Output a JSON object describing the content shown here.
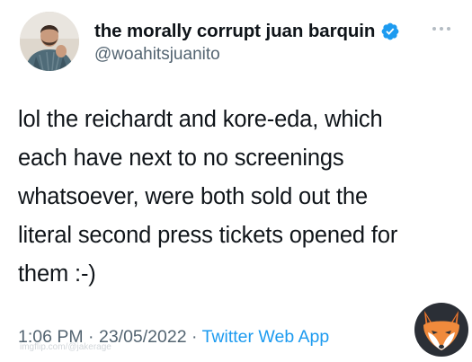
{
  "tweet": {
    "display_name": "the morally corrupt juan barquin",
    "handle": "@woahitsjuanito",
    "verified": true,
    "verified_icon": "verified-badge-icon",
    "more_icon": "more-options-icon",
    "text": "lol the reichardt and kore-eda, which\neach have next to no screenings\nwhatsoever, were both sold out the\nliteral second press tickets opened for\nthem :-)",
    "time": "1:06 PM",
    "separator": "·",
    "date": "23/05/2022",
    "source": "Twitter Web App"
  },
  "watermark": {
    "text": "imgflip.com/@jakerage",
    "logo_icon": "fox-logo-icon"
  },
  "colors": {
    "text_primary": "#0f1419",
    "text_secondary": "#536471",
    "accent": "#1d9bf0",
    "background": "#ffffff"
  }
}
